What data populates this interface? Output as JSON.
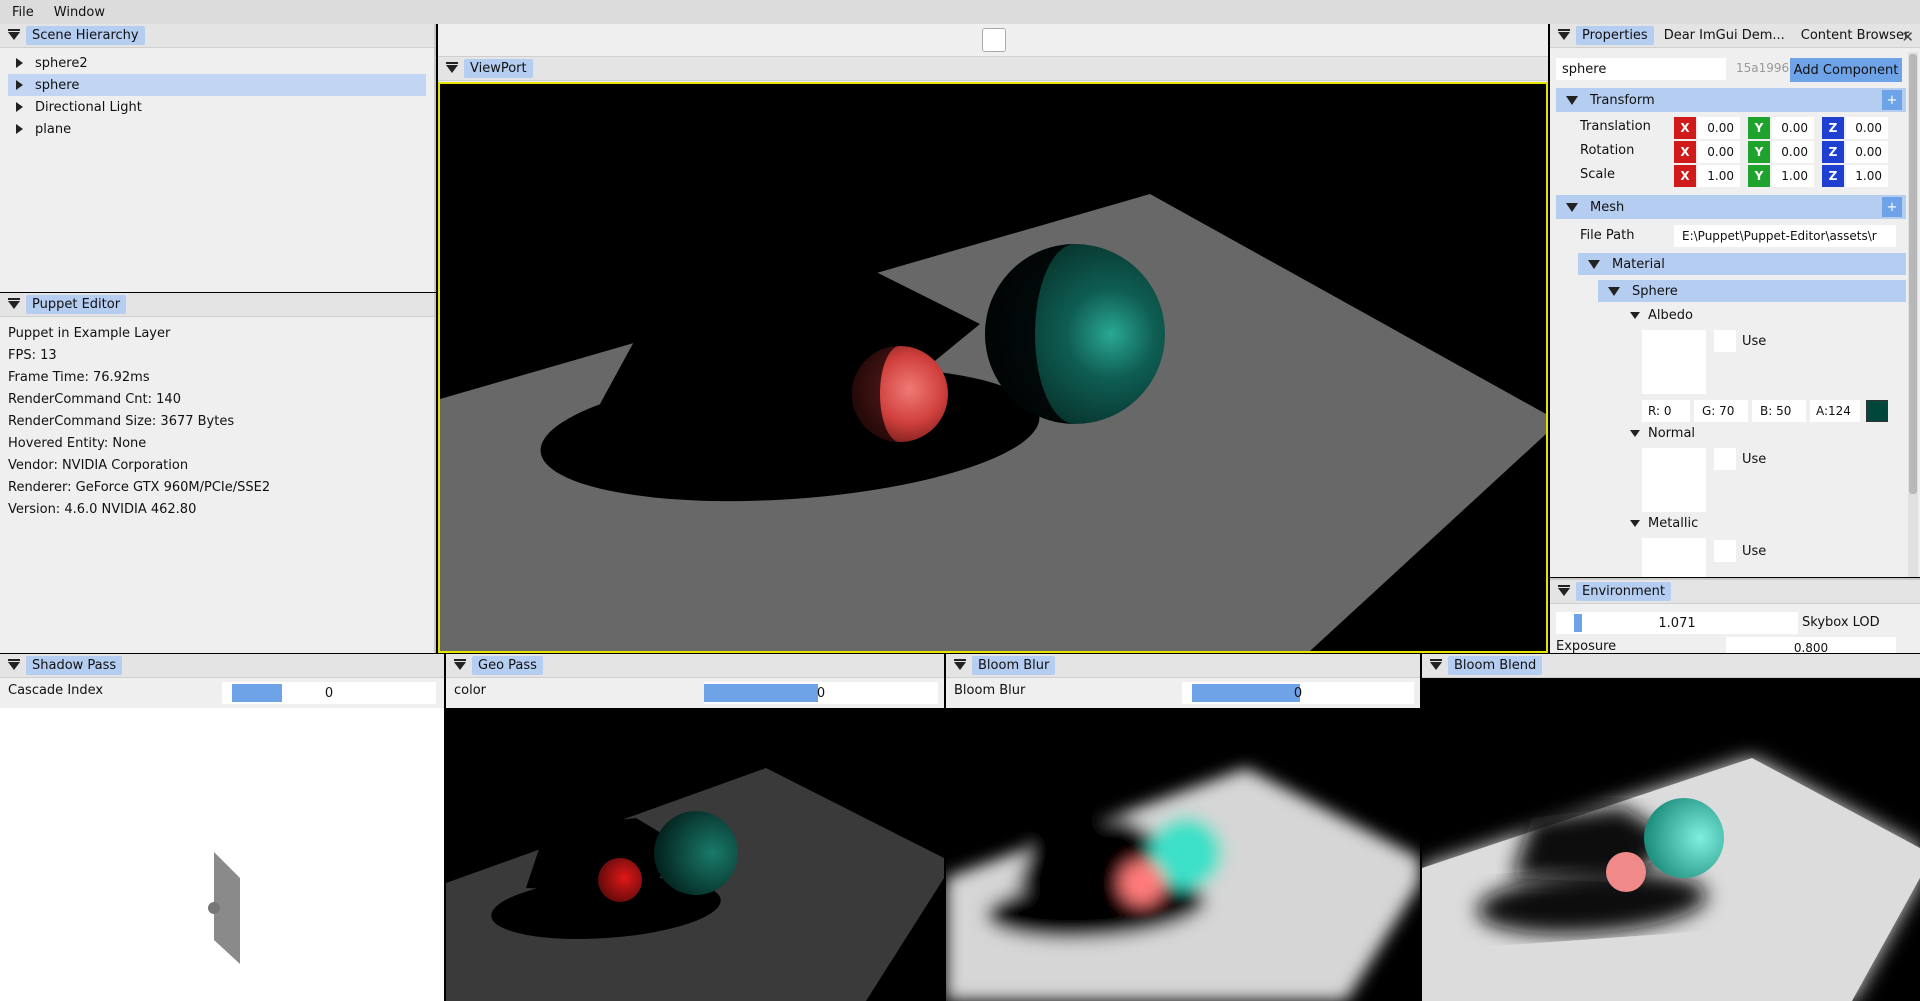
{
  "menu": {
    "file": "File",
    "window": "Window"
  },
  "scene_hierarchy": {
    "title": "Scene Hierarchy",
    "items": [
      {
        "label": "sphere2",
        "selected": false
      },
      {
        "label": "sphere",
        "selected": true
      },
      {
        "label": "Directional Light",
        "selected": false
      },
      {
        "label": "plane",
        "selected": false
      }
    ]
  },
  "puppet_editor": {
    "title": "Puppet Editor",
    "lines": [
      "Puppet in Example Layer",
      "FPS: 13",
      "Frame Time: 76.92ms",
      "RenderCommand Cnt: 140",
      "RenderCommand Size: 3677 Bytes",
      "Hovered Entity: None",
      "Vendor: NVIDIA Corporation",
      "Renderer: GeForce GTX 960M/PCIe/SSE2",
      "Version: 4.6.0 NVIDIA 462.80"
    ]
  },
  "viewport": {
    "title": "ViewPort"
  },
  "properties": {
    "tabs": [
      "Properties",
      "Dear ImGui Dem...",
      "Content Browser"
    ],
    "close_glyph": "✕",
    "entity_name": "sphere",
    "entity_id": "15a1996",
    "add_component": "Add Component",
    "plus": "+",
    "transform": {
      "title": "Transform",
      "rows": [
        {
          "label": "Translation",
          "x": "0.00",
          "y": "0.00",
          "z": "0.00"
        },
        {
          "label": "Rotation",
          "x": "0.00",
          "y": "0.00",
          "z": "0.00"
        },
        {
          "label": "Scale",
          "x": "1.00",
          "y": "1.00",
          "z": "1.00"
        }
      ],
      "axis_x": "X",
      "axis_y": "Y",
      "axis_z": "Z"
    },
    "mesh": {
      "title": "Mesh",
      "file_path_label": "File Path",
      "file_path_value": "E:\\Puppet\\Puppet-Editor\\assets\\r",
      "material_title": "Material",
      "sphere_title": "Sphere",
      "albedo": {
        "title": "Albedo",
        "use_label": "Use",
        "r": "R:  0",
        "g": "G: 70",
        "b": "B: 50",
        "a": "A:124",
        "swatch_color": "#00463a"
      },
      "normal": {
        "title": "Normal",
        "use_label": "Use"
      },
      "metallic": {
        "title": "Metallic",
        "use_label": "Use"
      }
    }
  },
  "environment": {
    "title": "Environment",
    "skybox_lod_value": "1.071",
    "skybox_lod_label": "Skybox LOD",
    "exposure_label": "Exposure",
    "exposure_value": "0.800"
  },
  "passes": [
    {
      "title": "Shadow Pass",
      "field_label": "Cascade Index",
      "value": "0"
    },
    {
      "title": "Geo Pass",
      "field_label": "color",
      "value": "0"
    },
    {
      "title": "Bloom Blur",
      "field_label": "Bloom Blur",
      "value": "0"
    },
    {
      "title": "Bloom Blend",
      "value": ""
    }
  ],
  "colors": {
    "accent": "#b5cdf0",
    "slider": "#6fa3e8",
    "viewport_border": "#e4e400"
  }
}
